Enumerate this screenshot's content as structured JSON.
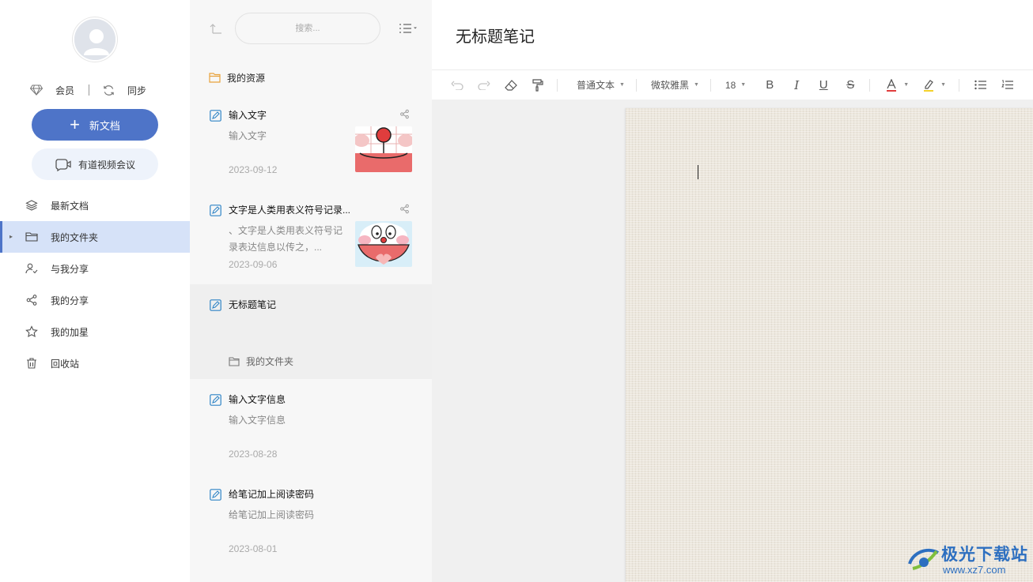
{
  "sidebar": {
    "vip_label": "会员",
    "sync_label": "同步",
    "new_doc_label": "新文档",
    "meeting_label": "有道视频会议",
    "items": [
      {
        "label": "最新文档",
        "icon": "layers-icon"
      },
      {
        "label": "我的文件夹",
        "icon": "folder-open-icon",
        "active": true
      },
      {
        "label": "与我分享",
        "icon": "shared-users-icon"
      },
      {
        "label": "我的分享",
        "icon": "share-icon"
      },
      {
        "label": "我的加星",
        "icon": "star-icon"
      },
      {
        "label": "回收站",
        "icon": "trash-icon"
      }
    ]
  },
  "list": {
    "search_placeholder": "搜索...",
    "resources_label": "我的资源",
    "notes": [
      {
        "title": "输入文字",
        "snippet": "输入文字",
        "date": "2023-09-12",
        "has_thumb": true
      },
      {
        "title": "文字是人类用表义符号记录...",
        "snippet": "、文字是人类用表义符号记录表达信息以传之，...",
        "date": "2023-09-06",
        "has_thumb": true
      },
      {
        "title": "无标题笔记",
        "folder": "我的文件夹",
        "selected": true
      },
      {
        "title": "输入文字信息",
        "snippet": "输入文字信息",
        "date": "2023-08-28"
      },
      {
        "title": "给笔记加上阅读密码",
        "snippet": "给笔记加上阅读密码",
        "date": "2023-08-01"
      }
    ]
  },
  "editor": {
    "title": "无标题笔记",
    "toolbar": {
      "paragraph_style": "普通文本",
      "font_family": "微软雅黑",
      "font_size": "18"
    }
  },
  "watermark": {
    "name": "极光下载站",
    "url": "www.xz7.com"
  },
  "colors": {
    "accent": "#4e74c8",
    "active_bg": "#d6e2f8",
    "paper": "#ece7dd"
  }
}
